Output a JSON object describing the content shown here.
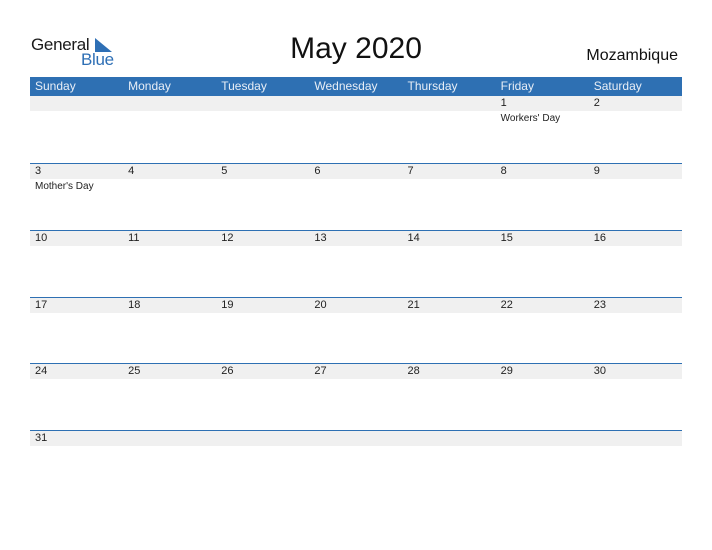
{
  "logo": {
    "general": "General",
    "blue": "Blue"
  },
  "header": {
    "title": "May 2020",
    "country": "Mozambique"
  },
  "colors": {
    "accent": "#2e70b3",
    "band": "#f0f0f0"
  },
  "days": [
    "Sunday",
    "Monday",
    "Tuesday",
    "Wednesday",
    "Thursday",
    "Friday",
    "Saturday"
  ],
  "weeks": [
    [
      {
        "d": ""
      },
      {
        "d": ""
      },
      {
        "d": ""
      },
      {
        "d": ""
      },
      {
        "d": ""
      },
      {
        "d": "1",
        "e": "Workers' Day"
      },
      {
        "d": "2"
      }
    ],
    [
      {
        "d": "3",
        "e": "Mother's Day"
      },
      {
        "d": "4"
      },
      {
        "d": "5"
      },
      {
        "d": "6"
      },
      {
        "d": "7"
      },
      {
        "d": "8"
      },
      {
        "d": "9"
      }
    ],
    [
      {
        "d": "10"
      },
      {
        "d": "11"
      },
      {
        "d": "12"
      },
      {
        "d": "13"
      },
      {
        "d": "14"
      },
      {
        "d": "15"
      },
      {
        "d": "16"
      }
    ],
    [
      {
        "d": "17"
      },
      {
        "d": "18"
      },
      {
        "d": "19"
      },
      {
        "d": "20"
      },
      {
        "d": "21"
      },
      {
        "d": "22"
      },
      {
        "d": "23"
      }
    ],
    [
      {
        "d": "24"
      },
      {
        "d": "25"
      },
      {
        "d": "26"
      },
      {
        "d": "27"
      },
      {
        "d": "28"
      },
      {
        "d": "29"
      },
      {
        "d": "30"
      }
    ],
    [
      {
        "d": "31"
      },
      {
        "d": ""
      },
      {
        "d": ""
      },
      {
        "d": ""
      },
      {
        "d": ""
      },
      {
        "d": ""
      },
      {
        "d": ""
      }
    ]
  ]
}
